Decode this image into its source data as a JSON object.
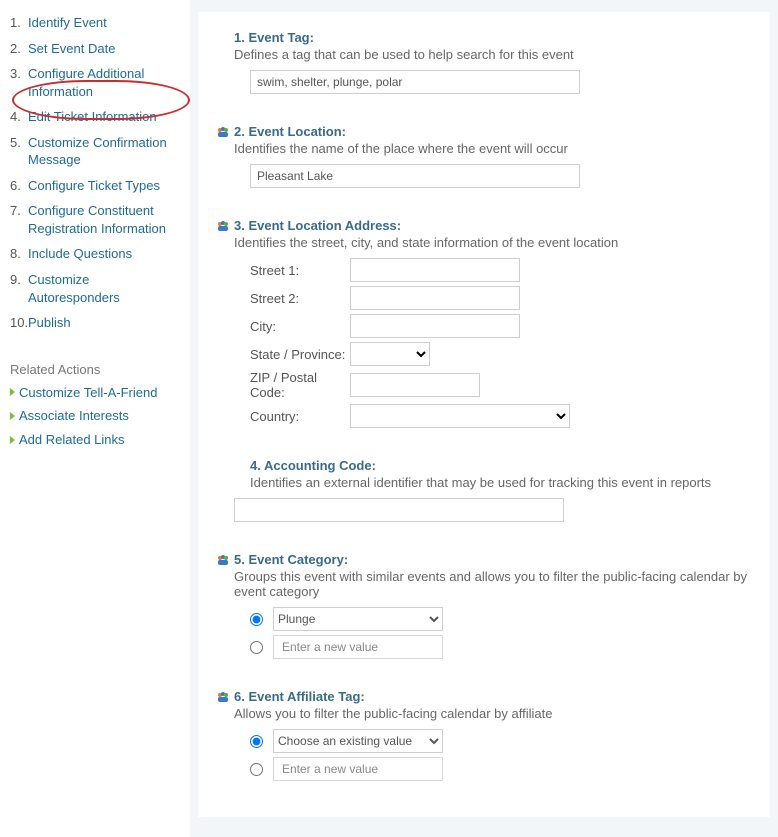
{
  "sidebar": {
    "steps": [
      {
        "num": "1.",
        "label": "Identify Event"
      },
      {
        "num": "2.",
        "label": "Set Event Date"
      },
      {
        "num": "3.",
        "label": "Configure Additional Information"
      },
      {
        "num": "4.",
        "label": "Edit Ticket Information"
      },
      {
        "num": "5.",
        "label": "Customize Confirmation Message"
      },
      {
        "num": "6.",
        "label": "Configure Ticket Types"
      },
      {
        "num": "7.",
        "label": "Configure Constituent Registration Information"
      },
      {
        "num": "8.",
        "label": "Include Questions"
      },
      {
        "num": "9.",
        "label": "Customize Autoresponders"
      },
      {
        "num": "10.",
        "label": "Publish"
      }
    ],
    "related_hdr": "Related Actions",
    "related": [
      "Customize Tell-A-Friend",
      "Associate Interests",
      "Add Related Links"
    ]
  },
  "fields": {
    "tag": {
      "title": "1. Event Tag:",
      "desc": "Defines a tag that can be used to help search for this event",
      "value": "swim, shelter, plunge, polar"
    },
    "location": {
      "title": "2. Event Location:",
      "desc": "Identifies the name of the place where the event will occur",
      "value": "Pleasant Lake"
    },
    "address": {
      "title": "3. Event Location Address:",
      "desc": "Identifies the street, city, and state information of the event location",
      "labels": {
        "street1": "Street 1:",
        "street2": "Street 2:",
        "city": "City:",
        "state": "State / Province:",
        "zip": "ZIP / Postal Code:",
        "country": "Country:"
      },
      "values": {
        "street1": "",
        "street2": "",
        "city": "",
        "state": "",
        "zip": "",
        "country": ""
      }
    },
    "accounting": {
      "title": "4. Accounting Code:",
      "desc": "Identifies an external identifier that may be used for tracking this event in reports",
      "value": ""
    },
    "category": {
      "title": "5. Event Category:",
      "desc": "Groups this event with similar events and allows you to filter the public-facing calendar by event category",
      "selected": "Plunge",
      "new_placeholder": "Enter a new value"
    },
    "affiliate": {
      "title": "6. Event Affiliate Tag:",
      "desc": "Allows you to filter the public-facing calendar by affiliate",
      "selected": "Choose an existing value",
      "new_placeholder": "Enter a new value"
    }
  }
}
